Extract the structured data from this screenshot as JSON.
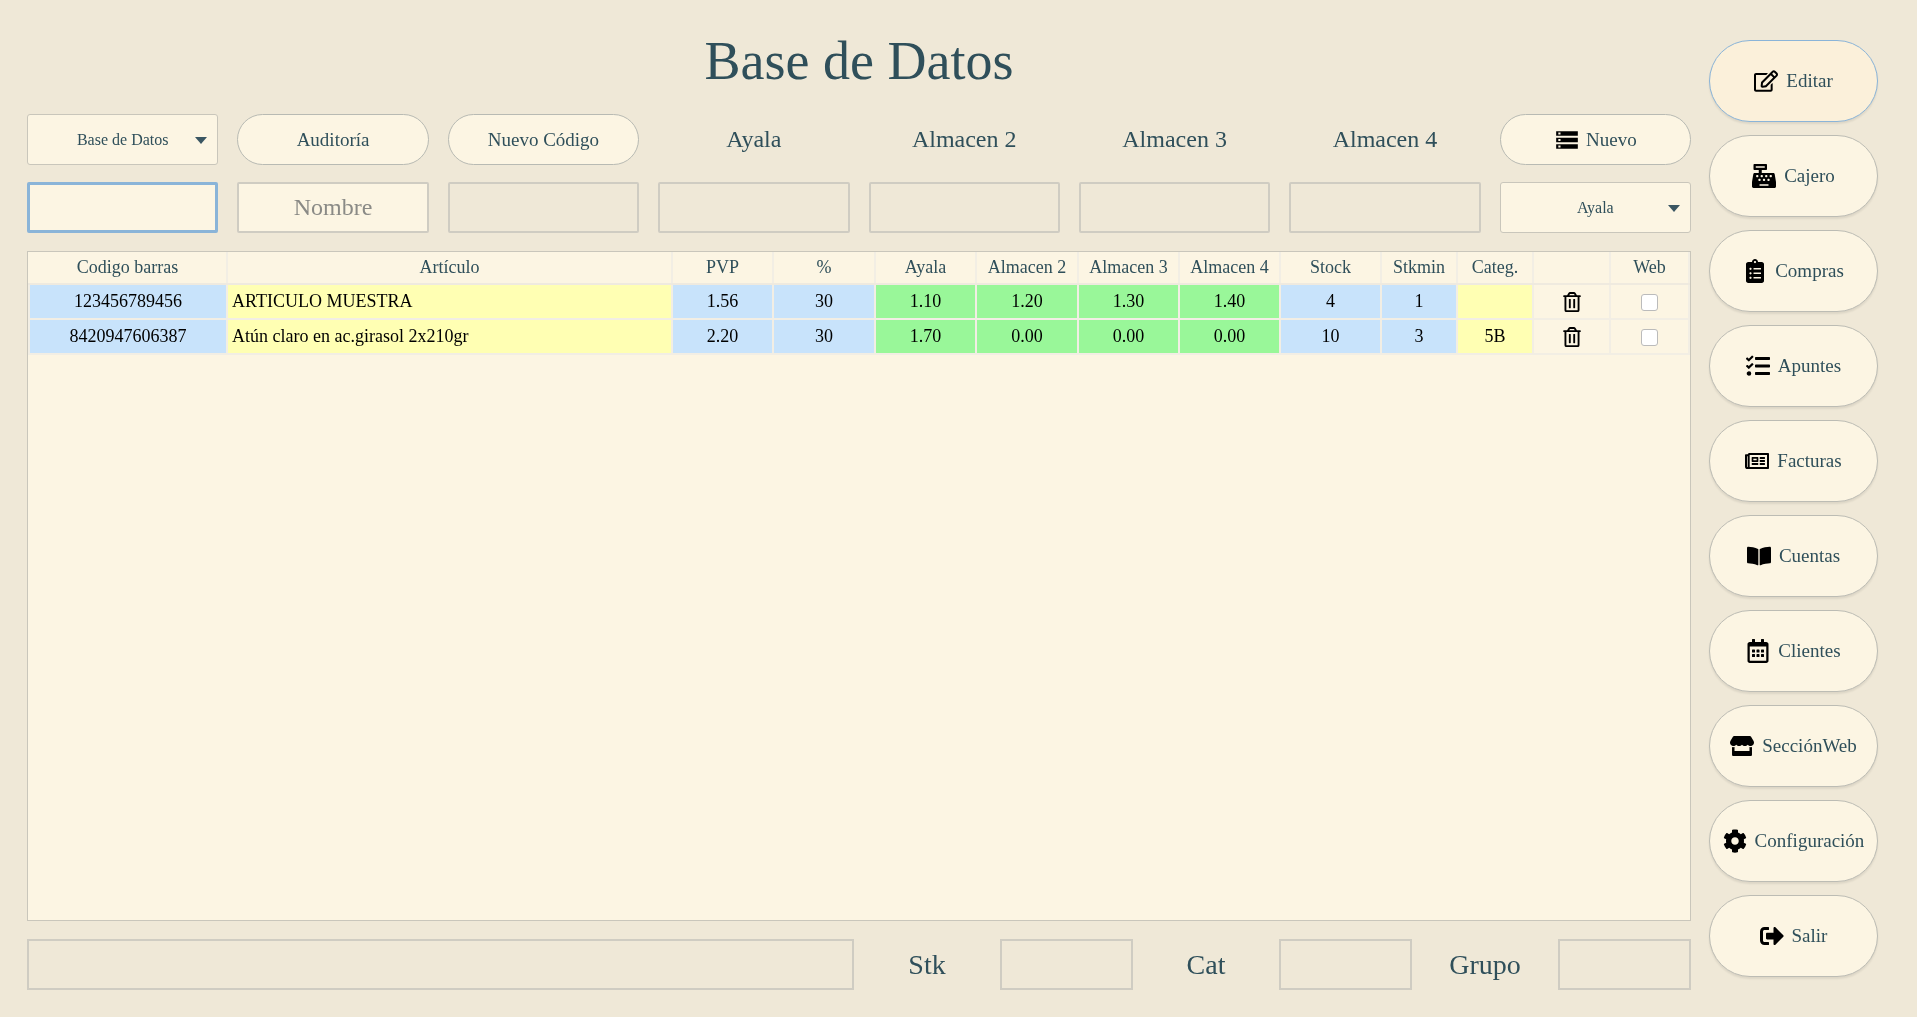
{
  "title": "Base de Datos",
  "top_row": [
    {
      "kind": "select",
      "label": "Base de Datos"
    },
    {
      "kind": "button",
      "label": "Auditoría"
    },
    {
      "kind": "button",
      "label": "Nuevo Código"
    },
    {
      "kind": "label",
      "label": "Ayala"
    },
    {
      "kind": "label",
      "label": "Almacen 2"
    },
    {
      "kind": "label",
      "label": "Almacen 3"
    },
    {
      "kind": "label",
      "label": "Almacen 4"
    },
    {
      "kind": "button",
      "label": "Nuevo"
    }
  ],
  "filter_row": [
    {
      "kind": "input",
      "focused": true
    },
    {
      "kind": "input",
      "placeholder": "Nombre",
      "focused": false
    },
    {
      "kind": "input",
      "focused": false
    },
    {
      "kind": "input",
      "focused": false
    },
    {
      "kind": "input",
      "focused": false
    },
    {
      "kind": "input",
      "focused": false
    },
    {
      "kind": "input",
      "focused": false
    },
    {
      "kind": "select",
      "label": "Ayala"
    }
  ],
  "table": {
    "columns": [
      {
        "label": "Codigo barras",
        "kind": "text"
      },
      {
        "label": "Artículo",
        "kind": "text"
      },
      {
        "label": "PVP",
        "kind": "text"
      },
      {
        "label": "%",
        "kind": "text"
      },
      {
        "label": "Ayala",
        "kind": "text"
      },
      {
        "label": "Almacen 2",
        "kind": "text"
      },
      {
        "label": "Almacen 3",
        "kind": "text"
      },
      {
        "label": "Almacen 4",
        "kind": "text"
      },
      {
        "label": "Stock",
        "kind": "text"
      },
      {
        "label": "Stkmin",
        "kind": "text"
      },
      {
        "label": "Categ.",
        "kind": "text"
      },
      {
        "kind": "delete"
      },
      {
        "label": "Web",
        "kind": "check"
      }
    ],
    "rows": [
      {
        "cells": [
          "123456789456",
          "ARTICULO MUESTRA",
          "1.56",
          "30",
          "1.10",
          "1.20",
          "1.30",
          "1.40",
          "4",
          "1",
          null
        ],
        "web_checked": false
      },
      {
        "cells": [
          "8420947606387",
          "Atún claro en ac.girasol 2x210gr",
          "2.20",
          "30",
          "1.70",
          "0.00",
          "0.00",
          "0.00",
          "10",
          "3",
          "5B"
        ],
        "web_checked": false
      }
    ]
  },
  "bottom_row": [
    {
      "kind": "field"
    },
    {
      "kind": "label",
      "label": "Stk"
    },
    {
      "kind": "field"
    },
    {
      "kind": "label",
      "label": "Cat"
    },
    {
      "kind": "field"
    },
    {
      "kind": "label",
      "label": "Grupo"
    },
    {
      "kind": "field"
    }
  ],
  "sidebar": [
    {
      "label": "Editar",
      "selected": true
    },
    {
      "label": "Cajero",
      "selected": false
    },
    {
      "label": "Compras",
      "selected": false
    },
    {
      "label": "Apuntes",
      "selected": false
    },
    {
      "label": "Facturas",
      "selected": false
    },
    {
      "label": "Cuentas",
      "selected": false
    },
    {
      "label": "Clientes",
      "selected": false
    },
    {
      "label": "SecciónWeb",
      "selected": false
    },
    {
      "label": "Configuración",
      "selected": false
    },
    {
      "label": "Salir",
      "selected": false
    }
  ]
}
